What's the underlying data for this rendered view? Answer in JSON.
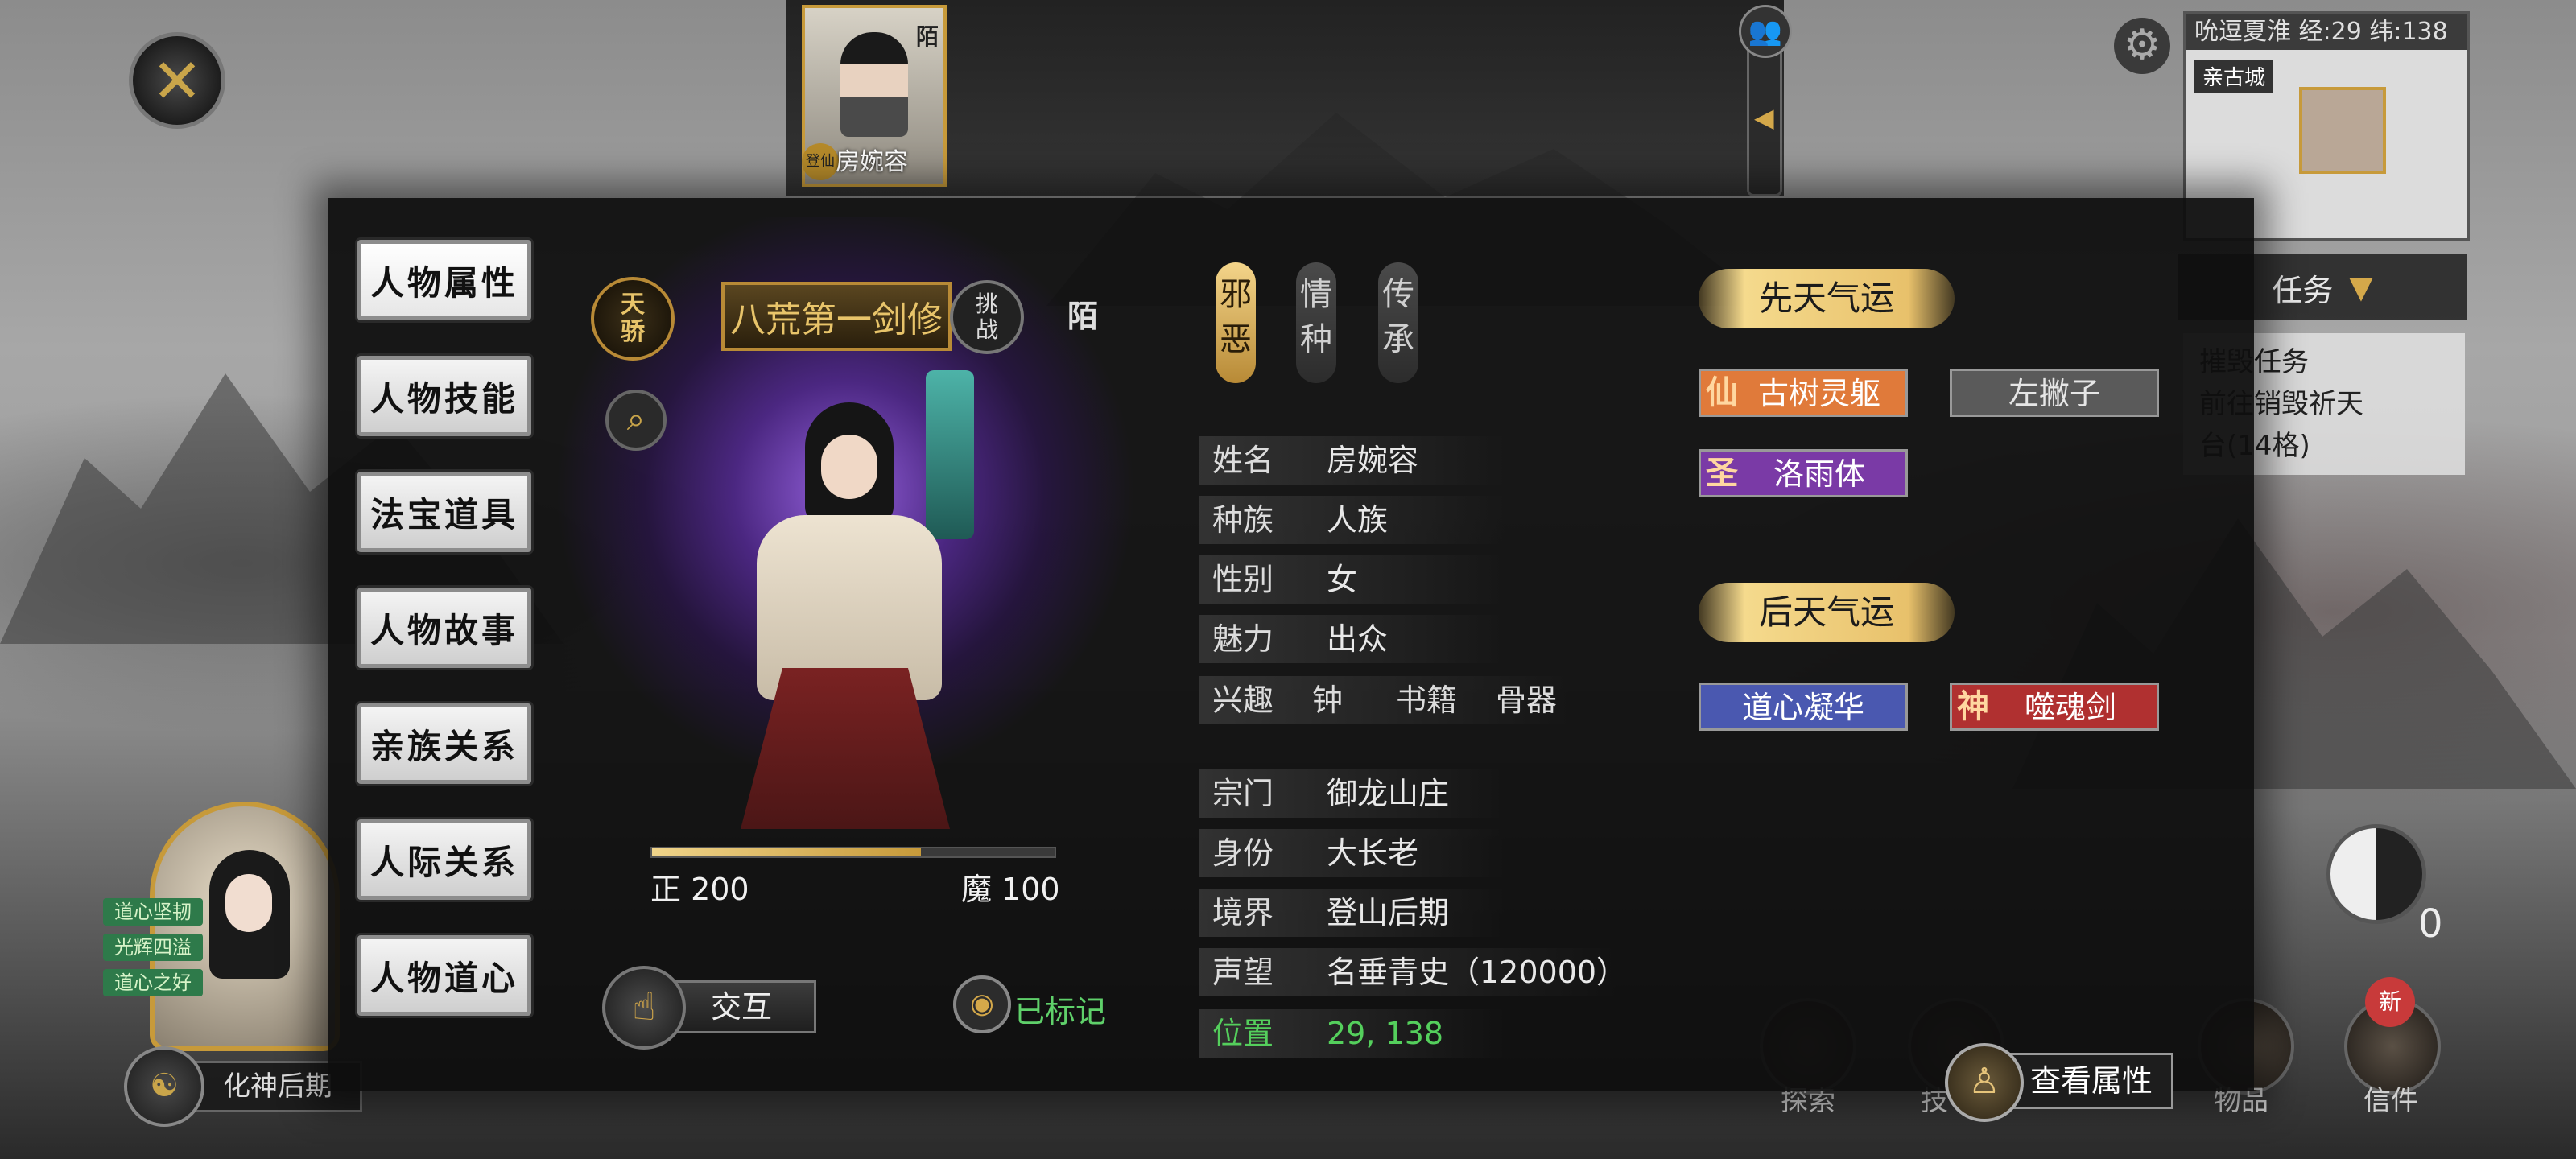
{
  "top_bar": {
    "portrait_name": "房婉容",
    "portrait_rank": "登仙",
    "portrait_tag": "陌"
  },
  "minimap": {
    "header": "吮逗夏淮 经:29 纬:138",
    "location": "亲古城"
  },
  "task_panel": {
    "tab_label": "任务",
    "line1": "摧毁任务",
    "line2": "前往销毁祈天",
    "line3": "台(14格)"
  },
  "menu": [
    {
      "label": "人物属性",
      "active": true
    },
    {
      "label": "人物技能",
      "active": false
    },
    {
      "label": "法宝道具",
      "active": false
    },
    {
      "label": "人物故事",
      "active": false
    },
    {
      "label": "亲族关系",
      "active": false
    },
    {
      "label": "人际关系",
      "active": false
    },
    {
      "label": "人物道心",
      "active": false
    }
  ],
  "character": {
    "badge_top": "天",
    "badge_bottom": "骄",
    "title": "八荒第一剑修",
    "challenge_top": "挑",
    "challenge_bottom": "战",
    "relation_tag": "陌",
    "zheng_label": "正 200",
    "mo_label": "魔 100",
    "zheng_ratio": 0.667,
    "interact_label": "交互",
    "marked_label": "已标记"
  },
  "vertical_tabs": [
    {
      "top": "邪",
      "bottom": "恶",
      "active": true
    },
    {
      "top": "情",
      "bottom": "种",
      "active": false
    },
    {
      "top": "传",
      "bottom": "承",
      "active": false
    }
  ],
  "info": {
    "name_k": "姓名",
    "name_v": "房婉容",
    "race_k": "种族",
    "race_v": "人族",
    "gender_k": "性别",
    "gender_v": "女",
    "charm_k": "魅力",
    "charm_v": "出众",
    "hobby_k": "兴趣",
    "hobbies": [
      "钟",
      "书籍",
      "骨器"
    ],
    "sect_k": "宗门",
    "sect_v": "御龙山庄",
    "role_k": "身份",
    "role_v": "大长老",
    "realm_k": "境界",
    "realm_v": "登山后期",
    "fame_k": "声望",
    "fame_v": "名垂青史（120000）",
    "pos_k": "位置",
    "pos_v": "29, 138"
  },
  "fortune": {
    "innate_header": "先天气运",
    "innate": [
      {
        "glyph": "仙",
        "label": "古树灵躯",
        "color": "#e07a3a"
      },
      {
        "glyph": "",
        "label": "左撇子",
        "color": "#5a5a5a"
      },
      {
        "glyph": "圣",
        "label": "洛雨体",
        "color": "#7a3aa6"
      }
    ],
    "acquired_header": "后天气运",
    "acquired": [
      {
        "glyph": "",
        "label": "道心凝华",
        "color": "#4a58b0"
      },
      {
        "glyph": "神",
        "label": "噬魂剑",
        "color": "#b03030"
      }
    ]
  },
  "view_attr_label": "查看属性",
  "player": {
    "tags": [
      "道心坚韧",
      "光辉四溢",
      "道心之好"
    ],
    "realm_label": "化神后期"
  },
  "hud": {
    "explore": "探索",
    "skill": "技",
    "items": "物品",
    "mail": "信件",
    "mail_badge": "新",
    "taiji_count": "0"
  }
}
